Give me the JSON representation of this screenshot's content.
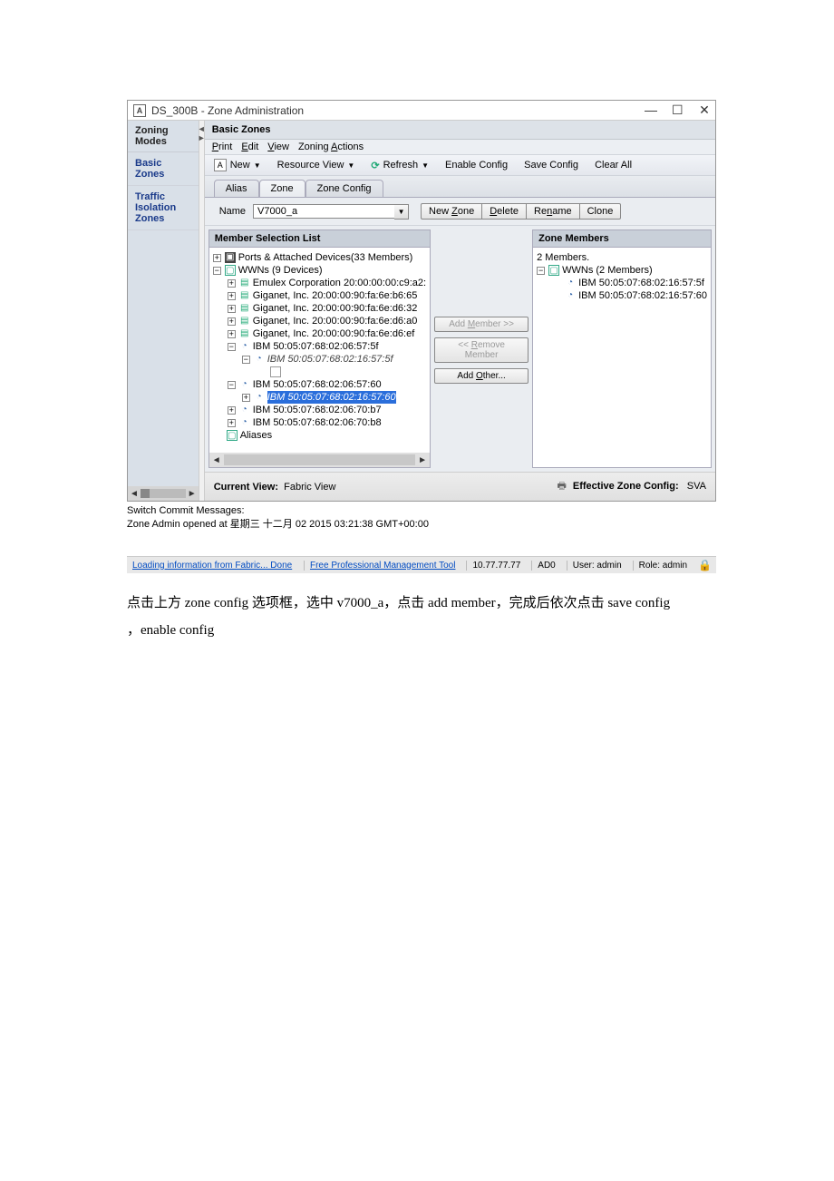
{
  "window": {
    "title": "DS_300B - Zone Administration",
    "min": "—",
    "max": "☐",
    "close": "✕"
  },
  "sidebar": {
    "title": "Zoning Modes",
    "items": [
      {
        "label": "Basic Zones"
      },
      {
        "label": "Traffic Isolation Zones"
      }
    ]
  },
  "panel": {
    "header": "Basic Zones",
    "menus": {
      "print": "Print",
      "edit": "Edit",
      "view": "View",
      "actions": "Zoning Actions"
    },
    "toolbar": {
      "new": "New",
      "resource_view": "Resource View",
      "refresh": "Refresh",
      "enable_config": "Enable Config",
      "save_config": "Save Config",
      "clear_all": "Clear All"
    },
    "tabs": {
      "alias": "Alias",
      "zone": "Zone",
      "zone_config": "Zone Config"
    },
    "name_row": {
      "label": "Name",
      "value": "V7000_a",
      "new_zone": "New Zone",
      "delete": "Delete",
      "rename": "Rename",
      "clone": "Clone"
    },
    "left_list": {
      "title": "Member Selection List",
      "ports_root": "Ports & Attached Devices(33 Members)",
      "wwn_root": "WWNs (9 Devices)",
      "rows": {
        "emulex": "Emulex Corporation 20:00:00:00:c9:a2:",
        "gig1": "Giganet, Inc. 20:00:00:90:fa:6e:b6:65",
        "gig2": "Giganet, Inc. 20:00:00:90:fa:6e:d6:32",
        "gig3": "Giganet, Inc. 20:00:00:90:fa:6e:d6:a0",
        "gig4": "Giganet, Inc. 20:00:00:90:fa:6e:d6:ef",
        "ibm1": "IBM 50:05:07:68:02:06:57:5f",
        "ibm1_child": "IBM 50:05:07:68:02:16:57:5f",
        "ibm2": "IBM 50:05:07:68:02:06:57:60",
        "ibm2_child": "IBM 50:05:07:68:02:16:57:60",
        "ibm3": "IBM 50:05:07:68:02:06:70:b7",
        "ibm4": "IBM 50:05:07:68:02:06:70:b8",
        "aliases": "Aliases"
      }
    },
    "middle": {
      "add_member": "Add Member >>",
      "remove_member": "<< Remove Member",
      "add_other": "Add Other..."
    },
    "right_list": {
      "title": "Zone Members",
      "summary": "2 Members.",
      "wwn_root": "WWNs (2 Members)",
      "r1": "IBM 50:05:07:68:02:16:57:5f",
      "r2": "IBM 50:05:07:68:02:16:57:60"
    },
    "footer": {
      "current_view_label": "Current View:",
      "current_view_value": "Fabric View",
      "effective_label": "Effective Zone Config:",
      "effective_value": "SVA"
    }
  },
  "commit": {
    "header": "Switch Commit Messages:",
    "line": "Zone Admin opened at 星期三 十二月 02 2015 03:21:38 GMT+00:00"
  },
  "status": {
    "left": "Loading information from Fabric... Done",
    "link": "Free Professional Management Tool",
    "ip": "10.77.77.77",
    "ad": "AD0",
    "user": "User: admin",
    "role": "Role: admin"
  },
  "instructions": {
    "line1": "点击上方 zone config  选项框，选中 v7000_a，点击 add member，完成后依次点击 save config",
    "line2": "，enable config"
  }
}
